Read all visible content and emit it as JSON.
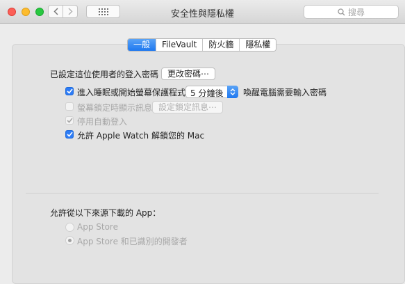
{
  "window": {
    "title": "安全性與隱私權",
    "search_placeholder": "搜尋"
  },
  "tabs": [
    {
      "label": "一般",
      "active": true
    },
    {
      "label": "FileVault",
      "active": false
    },
    {
      "label": "防火牆",
      "active": false
    },
    {
      "label": "隱私權",
      "active": false
    }
  ],
  "general": {
    "password_label": "已設定這位使用者的登入密碼",
    "change_password_button": "更改密碼⋯",
    "require_password": {
      "checked": true,
      "label_before": "進入睡眠或開始螢幕保護程式",
      "delay_value": "5 分鐘後",
      "label_after": "喚醒電腦需要輸入密碼"
    },
    "lock_message": {
      "checked": false,
      "enabled": false,
      "label": "螢幕鎖定時顯示訊息",
      "button": "設定鎖定訊息⋯"
    },
    "disable_auto_login": {
      "checked": true,
      "enabled": false,
      "label": "停用自動登入"
    },
    "apple_watch_unlock": {
      "checked": true,
      "label": "允許 Apple Watch 解鎖您的 Mac"
    }
  },
  "downloads": {
    "heading": "允許從以下來源下載的 App：",
    "options": [
      {
        "label": "App Store",
        "selected": false
      },
      {
        "label": "App Store 和已識別的開發者",
        "selected": true
      }
    ]
  },
  "colors": {
    "accent": "#2d7cf6",
    "close": "#fc5f57",
    "minimize": "#fdbc2e",
    "maximize": "#28c840"
  }
}
